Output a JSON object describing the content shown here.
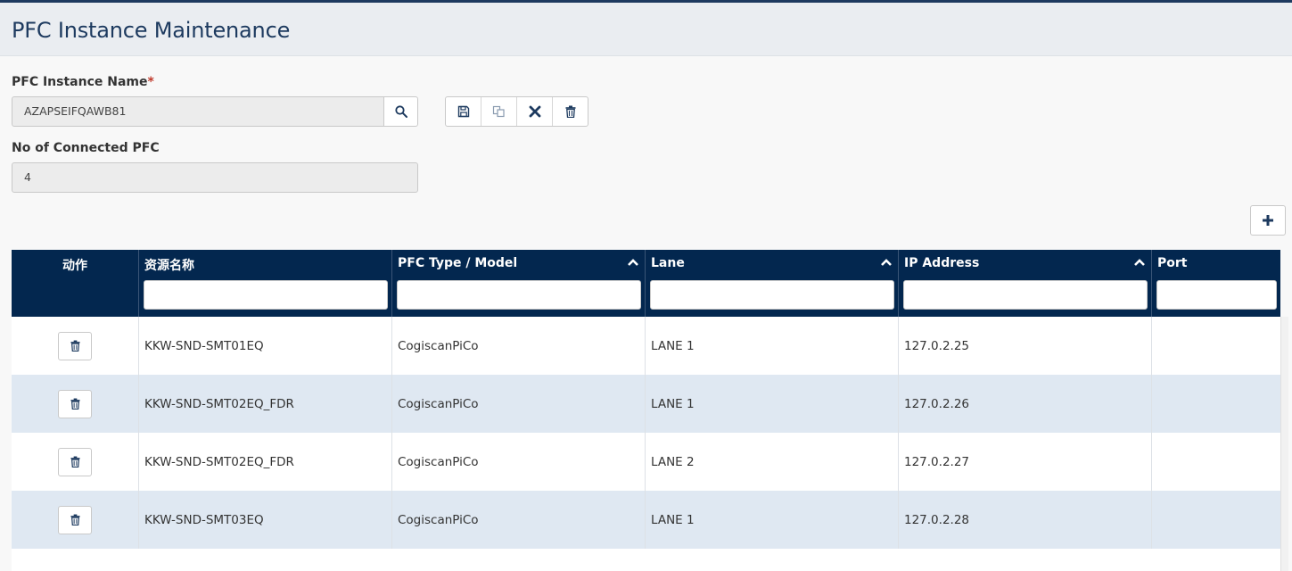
{
  "page": {
    "title": "PFC Instance Maintenance",
    "accent_color": "#03274f"
  },
  "form": {
    "instance_name_label": "PFC Instance Name",
    "required_mark": "*",
    "instance_name_value": "AZAPSEIFQAWB81",
    "connected_label": "No of Connected PFC",
    "connected_value": "4"
  },
  "toolbar": {
    "buttons": [
      {
        "name": "save",
        "icon": "floppy-disk-icon"
      },
      {
        "name": "copy",
        "icon": "copy-icon"
      },
      {
        "name": "cancel",
        "icon": "close-icon"
      },
      {
        "name": "delete",
        "icon": "trash-icon"
      }
    ],
    "add_icon": "plus-icon"
  },
  "grid": {
    "columns": [
      {
        "label": "动作",
        "sortable": false,
        "filter": false
      },
      {
        "label": "资源名称",
        "sortable": false,
        "filter": true
      },
      {
        "label": "PFC Type / Model",
        "sortable": true,
        "filter": true
      },
      {
        "label": "Lane",
        "sortable": true,
        "filter": true
      },
      {
        "label": "IP Address",
        "sortable": true,
        "filter": true
      },
      {
        "label": "Port",
        "sortable": false,
        "filter": true
      }
    ],
    "rows": [
      {
        "resource": "KKW-SND-SMT01EQ",
        "type": "CogiscanPiCo",
        "lane": "LANE 1",
        "ip": "127.0.2.25",
        "port": ""
      },
      {
        "resource": "KKW-SND-SMT02EQ_FDR",
        "type": "CogiscanPiCo",
        "lane": "LANE 1",
        "ip": "127.0.2.26",
        "port": ""
      },
      {
        "resource": "KKW-SND-SMT02EQ_FDR",
        "type": "CogiscanPiCo",
        "lane": "LANE 2",
        "ip": "127.0.2.27",
        "port": ""
      },
      {
        "resource": "KKW-SND-SMT03EQ",
        "type": "CogiscanPiCo",
        "lane": "LANE 1",
        "ip": "127.0.2.28",
        "port": ""
      }
    ]
  }
}
